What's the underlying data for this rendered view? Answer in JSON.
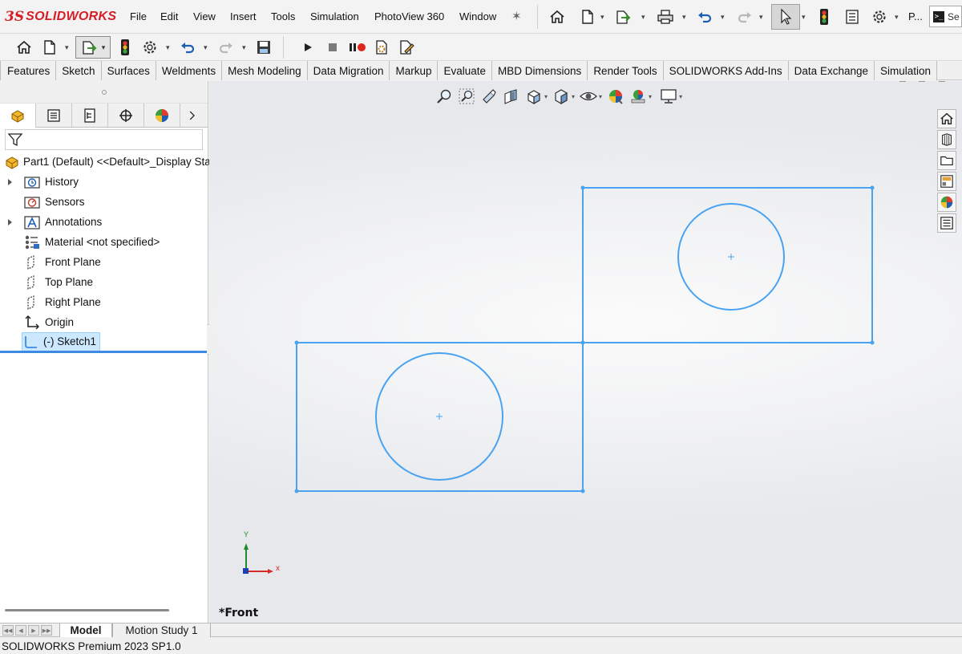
{
  "app": {
    "logo_mark": "3S",
    "logo_text": "SOLIDWORKS"
  },
  "menu": {
    "items": [
      "File",
      "Edit",
      "View",
      "Insert",
      "Tools",
      "Simulation",
      "PhotoView 360",
      "Window"
    ],
    "overflow_label": "P...",
    "command_prompt_glyph": ">_"
  },
  "cm_tabs": [
    "Features",
    "Sketch",
    "Surfaces",
    "Weldments",
    "Mesh Modeling",
    "Data Migration",
    "Markup",
    "Evaluate",
    "MBD Dimensions",
    "Render Tools",
    "SOLIDWORKS Add-Ins",
    "Data Exchange",
    "Simulation"
  ],
  "feature_tree": {
    "root": "Part1 (Default) <<Default>_Display Sta",
    "items": [
      {
        "label": "History",
        "icon": "history-folder-icon",
        "expandable": true
      },
      {
        "label": "Sensors",
        "icon": "sensors-folder-icon",
        "expandable": false
      },
      {
        "label": "Annotations",
        "icon": "annotations-folder-icon",
        "expandable": true
      },
      {
        "label": "Material <not specified>",
        "icon": "material-icon",
        "expandable": false
      },
      {
        "label": "Front Plane",
        "icon": "plane-icon",
        "expandable": false
      },
      {
        "label": "Top Plane",
        "icon": "plane-icon",
        "expandable": false
      },
      {
        "label": "Right Plane",
        "icon": "plane-icon",
        "expandable": false
      },
      {
        "label": "Origin",
        "icon": "origin-icon",
        "expandable": false
      },
      {
        "label": "(-) Sketch1",
        "icon": "sketch-icon",
        "expandable": false,
        "selected": true
      }
    ]
  },
  "graphics": {
    "view_label": "*Front",
    "triad": {
      "x_label": "x",
      "y_label": "Y"
    },
    "sketch_color": "#4aa3f0"
  },
  "bottom_tabs": [
    {
      "label": "Model",
      "active": true
    },
    {
      "label": "Motion Study 1",
      "active": false
    }
  ],
  "status_bar": {
    "text": "SOLIDWORKS Premium 2023 SP1.0"
  },
  "colors": {
    "brand_red": "#d51e25",
    "selection_bg": "#cce8ff",
    "tree_divider": "#3c8be0"
  }
}
